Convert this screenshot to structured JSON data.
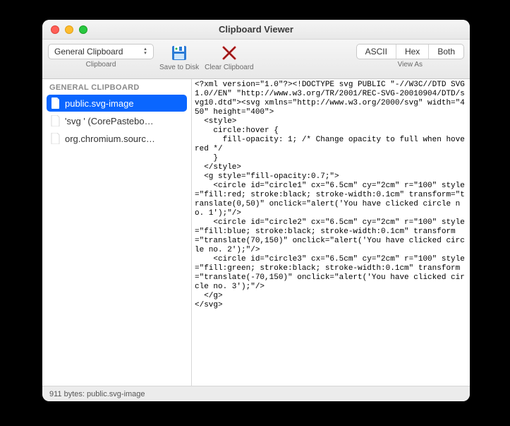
{
  "window": {
    "title": "Clipboard Viewer"
  },
  "toolbar": {
    "clipboard_selector": {
      "value": "General Clipboard",
      "label": "Clipboard"
    },
    "save": {
      "label": "Save to Disk"
    },
    "clear": {
      "label": "Clear Clipboard"
    },
    "view_as": {
      "label": "View As",
      "options": {
        "ascii": "ASCII",
        "hex": "Hex",
        "both": "Both"
      }
    }
  },
  "sidebar": {
    "section": "GENERAL CLIPBOARD",
    "items": [
      {
        "label": "public.svg-image",
        "selected": true
      },
      {
        "label": "'svg ' (CorePastebo…",
        "selected": false
      },
      {
        "label": "org.chromium.sourc…",
        "selected": false
      }
    ]
  },
  "content": "<?xml version=\"1.0\"?><!DOCTYPE svg PUBLIC \"-//W3C//DTD SVG 1.0//EN\" \"http://www.w3.org/TR/2001/REC-SVG-20010904/DTD/svg10.dtd\"><svg xmlns=\"http://www.w3.org/2000/svg\" width=\"450\" height=\"400\">\n  <style>\n    circle:hover {\n      fill-opacity: 1; /* Change opacity to full when hovered */\n    }\n  </style>\n  <g style=\"fill-opacity:0.7;\">\n    <circle id=\"circle1\" cx=\"6.5cm\" cy=\"2cm\" r=\"100\" style=\"fill:red; stroke:black; stroke-width:0.1cm\" transform=\"translate(0,50)\" onclick=\"alert('You have clicked circle no. 1');\"/>\n    <circle id=\"circle2\" cx=\"6.5cm\" cy=\"2cm\" r=\"100\" style=\"fill:blue; stroke:black; stroke-width:0.1cm\" transform=\"translate(70,150)\" onclick=\"alert('You have clicked circle no. 2');\"/>\n    <circle id=\"circle3\" cx=\"6.5cm\" cy=\"2cm\" r=\"100\" style=\"fill:green; stroke:black; stroke-width:0.1cm\" transform=\"translate(-70,150)\" onclick=\"alert('You have clicked circle no. 3');\"/>\n  </g>\n</svg>",
  "status": "911 bytes: public.svg-image"
}
